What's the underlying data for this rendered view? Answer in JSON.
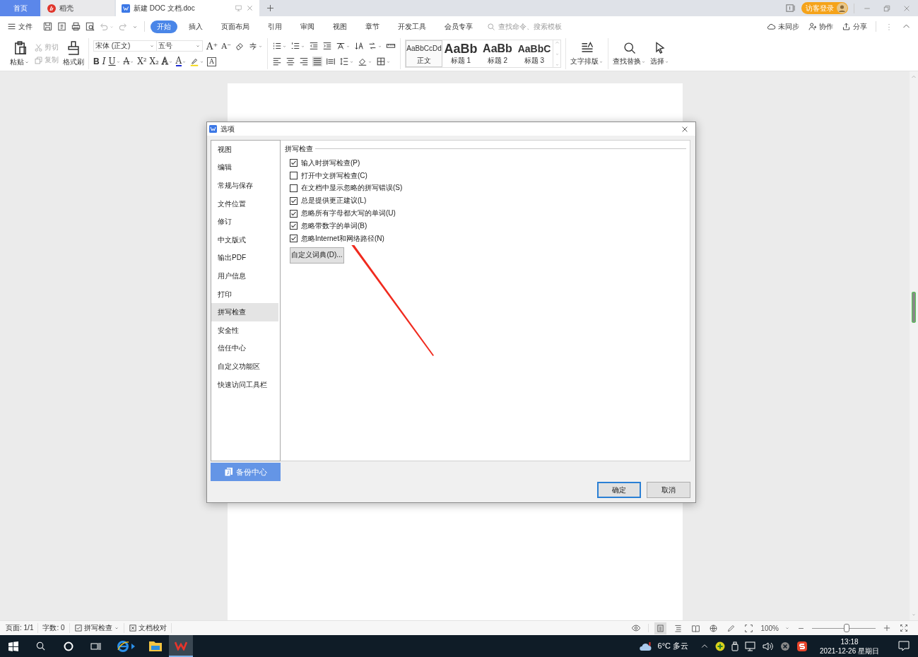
{
  "tabs": [
    {
      "label": "首页",
      "kind": "home",
      "selected": false
    },
    {
      "label": "稻壳",
      "kind": "docer",
      "selected": false
    },
    {
      "label": "新建 DOC 文档.doc",
      "kind": "doc",
      "selected": true
    }
  ],
  "title_bar": {
    "login": "访客登录"
  },
  "menu": {
    "file": "文件",
    "items": [
      {
        "label": "开始",
        "selected": true
      },
      {
        "label": "插入",
        "selected": false
      },
      {
        "label": "页面布局",
        "selected": false
      },
      {
        "label": "引用",
        "selected": false
      },
      {
        "label": "审阅",
        "selected": false
      },
      {
        "label": "视图",
        "selected": false
      },
      {
        "label": "章节",
        "selected": false
      },
      {
        "label": "开发工具",
        "selected": false
      },
      {
        "label": "会员专享",
        "selected": false
      }
    ],
    "search": {
      "placeholder": "查找命令、搜索模板"
    },
    "sync": "未同步",
    "collaborate": "协作",
    "share": "分享"
  },
  "ribbon": {
    "paste": "粘贴",
    "cut": {
      "label": "剪切",
      "disabled": true
    },
    "copy": {
      "label": "复制",
      "disabled": true
    },
    "format_painter": "格式刷",
    "font_name": "宋体 (正文)",
    "font_size": "五号",
    "font_tools": [
      {
        "label": "A⁺",
        "kind": "grow"
      },
      {
        "label": "A⁻",
        "kind": "shrink"
      }
    ],
    "format_buttons": [
      {
        "label": "B",
        "kind": "bold"
      },
      {
        "label": "I",
        "kind": "italic"
      },
      {
        "label": "U",
        "kind": "underline"
      },
      {
        "label": "A",
        "kind": "strike"
      },
      {
        "label": "X²",
        "kind": "sup"
      },
      {
        "label": "X₂",
        "kind": "sub"
      },
      {
        "label": "A",
        "kind": "outline"
      },
      {
        "label": "A",
        "kind": "color"
      },
      {
        "label": "A",
        "kind": "border"
      }
    ],
    "styles": [
      {
        "preview": "AaBbCcDd",
        "label": "正文",
        "kind": "body",
        "selected": true
      },
      {
        "preview": "AaBb",
        "label": "标题 1",
        "kind": "h1",
        "selected": false
      },
      {
        "preview": "AaBb",
        "label": "标题 2",
        "kind": "h2",
        "selected": false
      },
      {
        "preview": "AaBbC",
        "label": "标题 3",
        "kind": "h3",
        "selected": false
      }
    ],
    "text_layout": "文字排版",
    "find_replace": "查找替换",
    "select": "选择"
  },
  "dialog": {
    "title": "选项",
    "nav": [
      {
        "label": "视图",
        "selected": false
      },
      {
        "label": "编辑",
        "selected": false
      },
      {
        "label": "常规与保存",
        "selected": false
      },
      {
        "label": "文件位置",
        "selected": false
      },
      {
        "label": "修订",
        "selected": false
      },
      {
        "label": "中文版式",
        "selected": false
      },
      {
        "label": "输出PDF",
        "selected": false
      },
      {
        "label": "用户信息",
        "selected": false
      },
      {
        "label": "打印",
        "selected": false
      },
      {
        "label": "拼写检查",
        "selected": true
      },
      {
        "label": "安全性",
        "selected": false
      },
      {
        "label": "信任中心",
        "selected": false
      },
      {
        "label": "自定义功能区",
        "selected": false
      },
      {
        "label": "快速访问工具栏",
        "selected": false
      }
    ],
    "backup": "备份中心",
    "section": "拼写检查",
    "options": [
      {
        "label": "输入时拼写检查(P)",
        "checked": true
      },
      {
        "label": "打开中文拼写检查(C)",
        "checked": false
      },
      {
        "label": "在文档中显示忽略的拼写错误(S)",
        "checked": false
      },
      {
        "label": "总是提供更正建议(L)",
        "checked": true
      },
      {
        "label": "忽略所有字母都大写的单词(U)",
        "checked": true
      },
      {
        "label": "忽略带数字的单词(B)",
        "checked": true
      },
      {
        "label": "忽略Internet和网络路径(N)",
        "checked": true
      }
    ],
    "dictionary_button": "自定义词典(D)...",
    "ok": "确定",
    "cancel": "取消"
  },
  "status_bar": {
    "page": "页面: 1/1",
    "words": "字数: 0",
    "spell_check": "拼写检查",
    "proofread": "文档校对",
    "zoom": "100%",
    "zoom_slider": {
      "level": 0.55
    }
  },
  "taskbar": {
    "weather": "6°C 多云",
    "time": "13:18",
    "date": "2021-12-26 星期日"
  }
}
